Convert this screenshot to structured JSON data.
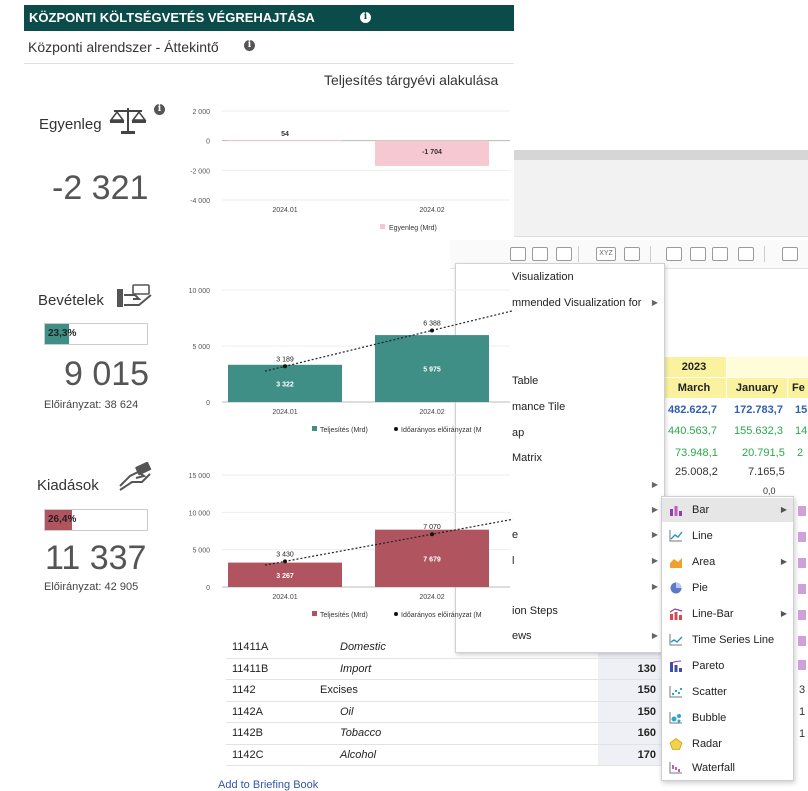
{
  "header": {
    "title": "KÖZPONTI KÖLTSÉGVETÉS VÉGREHAJTÁSA",
    "subtitle": "Központi alrendszer - Áttekintő",
    "chart_heading": "Teljesítés tárgyévi alakulása"
  },
  "kpis": [
    {
      "label": "Egyenleg",
      "value": "-2 321",
      "icon": "scales-icon"
    },
    {
      "label": "Bevételek",
      "value": "9 015",
      "percent_text": "23,3%",
      "percent": 23.3,
      "bar_color": "#3f8f86",
      "approp_label": "Előirányzat:",
      "approp_value": "38 624",
      "icon": "hand-money-icon"
    },
    {
      "label": "Kiadások",
      "value": "11 337",
      "percent_text": "26,4%",
      "percent": 26.4,
      "bar_color": "#b05560",
      "approp_label": "Előirányzat:",
      "approp_value": "42 905",
      "icon": "hand-coins-icon"
    }
  ],
  "chart_data": [
    {
      "type": "bar",
      "categories": [
        "2024.01",
        "2024.02"
      ],
      "series": [
        {
          "name": "Egyenleg (Mrd)",
          "values": [
            54,
            -1704
          ],
          "color": "#f6c8d2"
        }
      ],
      "ylim": [
        -4000,
        2000
      ],
      "yticks": [
        "2 000",
        "0",
        "-2 000",
        "-4 000"
      ],
      "value_labels": [
        "54",
        "-1 704"
      ]
    },
    {
      "type": "bar",
      "categories": [
        "2024.01",
        "2024.02"
      ],
      "series": [
        {
          "name": "Teljesítés (Mrd)",
          "values": [
            3322,
            5975
          ],
          "color": "#3f8f86"
        },
        {
          "name": "Időarányos előirányzat (M",
          "values": [
            3189,
            6388
          ],
          "style": "dotted-line"
        }
      ],
      "ylim": [
        0,
        10000
      ],
      "yticks": [
        "10 000",
        "5 000",
        "0"
      ],
      "bar_labels": [
        "3 322",
        "5 975"
      ],
      "line_labels": [
        "3 189",
        "6 388"
      ]
    },
    {
      "type": "bar",
      "categories": [
        "2024.01",
        "2024.02"
      ],
      "series": [
        {
          "name": "Teljesítés (Mrd)",
          "values": [
            3267,
            7679
          ],
          "color": "#b05560"
        },
        {
          "name": "Időarányos előirányzat (M",
          "values": [
            3430,
            7070
          ],
          "style": "dotted-line"
        }
      ],
      "ylim": [
        0,
        15000
      ],
      "yticks": [
        "15 000",
        "10 000",
        "5 000",
        "0"
      ],
      "bar_labels": [
        "3 267",
        "7 679"
      ],
      "line_labels": [
        "3 430",
        "7 070"
      ]
    }
  ],
  "context_menu": {
    "items": [
      {
        "label": "Visualization",
        "arrow": ""
      },
      {
        "label": "mmended Visualization for",
        "arrow": "▶"
      },
      {
        "label": "Table",
        "arrow": ""
      },
      {
        "label": "mance Tile",
        "arrow": ""
      },
      {
        "label": "ap",
        "arrow": ""
      },
      {
        "label": "Matrix",
        "arrow": ""
      },
      {
        "label": "",
        "arrow": "▶"
      },
      {
        "label": "",
        "arrow": "▶"
      },
      {
        "label": "e",
        "arrow": "▶"
      },
      {
        "label": "l",
        "arrow": "▶"
      },
      {
        "label": "",
        "arrow": "▶"
      },
      {
        "label": "ion Steps",
        "arrow": ""
      },
      {
        "label": "ews",
        "arrow": "▶"
      }
    ]
  },
  "submenu": {
    "items": [
      {
        "label": "Bar",
        "icon": "bar-chart-icon",
        "arrow": "▶",
        "highlighted": true
      },
      {
        "label": "Line",
        "icon": "line-chart-icon",
        "arrow": ""
      },
      {
        "label": "Area",
        "icon": "area-chart-icon",
        "arrow": "▶"
      },
      {
        "label": "Pie",
        "icon": "pie-chart-icon",
        "arrow": ""
      },
      {
        "label": "Line-Bar",
        "icon": "line-bar-chart-icon",
        "arrow": "▶"
      },
      {
        "label": "Time Series Line",
        "icon": "time-series-icon",
        "arrow": ""
      },
      {
        "label": "Pareto",
        "icon": "pareto-chart-icon",
        "arrow": ""
      },
      {
        "label": "Scatter",
        "icon": "scatter-chart-icon",
        "arrow": ""
      },
      {
        "label": "Bubble",
        "icon": "bubble-chart-icon",
        "arrow": ""
      },
      {
        "label": "Radar",
        "icon": "radar-chart-icon",
        "arrow": ""
      },
      {
        "label": "Waterfall",
        "icon": "waterfall-chart-icon",
        "arrow": ""
      }
    ]
  },
  "pivot": {
    "year": "2023",
    "months": [
      "March",
      "January",
      "Fe"
    ],
    "rows": [
      [
        "482.622,7",
        "172.783,7",
        "15"
      ],
      [
        "440.563,7",
        "155.632,3",
        "14"
      ],
      [
        "73.948,1",
        "20.791,5",
        "2"
      ],
      [
        "25.008,2",
        "7.165,5",
        ""
      ],
      [
        "",
        "0,0",
        ""
      ]
    ],
    "edge_values": [
      "3",
      "1",
      "1"
    ]
  },
  "data_table": {
    "rows": [
      {
        "code": "11411A",
        "name": "Domestic",
        "italic": true,
        "value": ""
      },
      {
        "code": "11411B",
        "name": "Import",
        "italic": true,
        "value": "130"
      },
      {
        "code": "1142",
        "name": "Excises",
        "italic": false,
        "value": "150"
      },
      {
        "code": "1142A",
        "name": "Oil",
        "italic": true,
        "value": "150"
      },
      {
        "code": "1142B",
        "name": "Tobacco",
        "italic": true,
        "value": "160"
      },
      {
        "code": "1142C",
        "name": "Alcohol",
        "italic": true,
        "value": "170"
      }
    ],
    "briefing_link": "Add to Briefing Book"
  },
  "toolbar": {
    "xyz_label": "XYZ"
  }
}
